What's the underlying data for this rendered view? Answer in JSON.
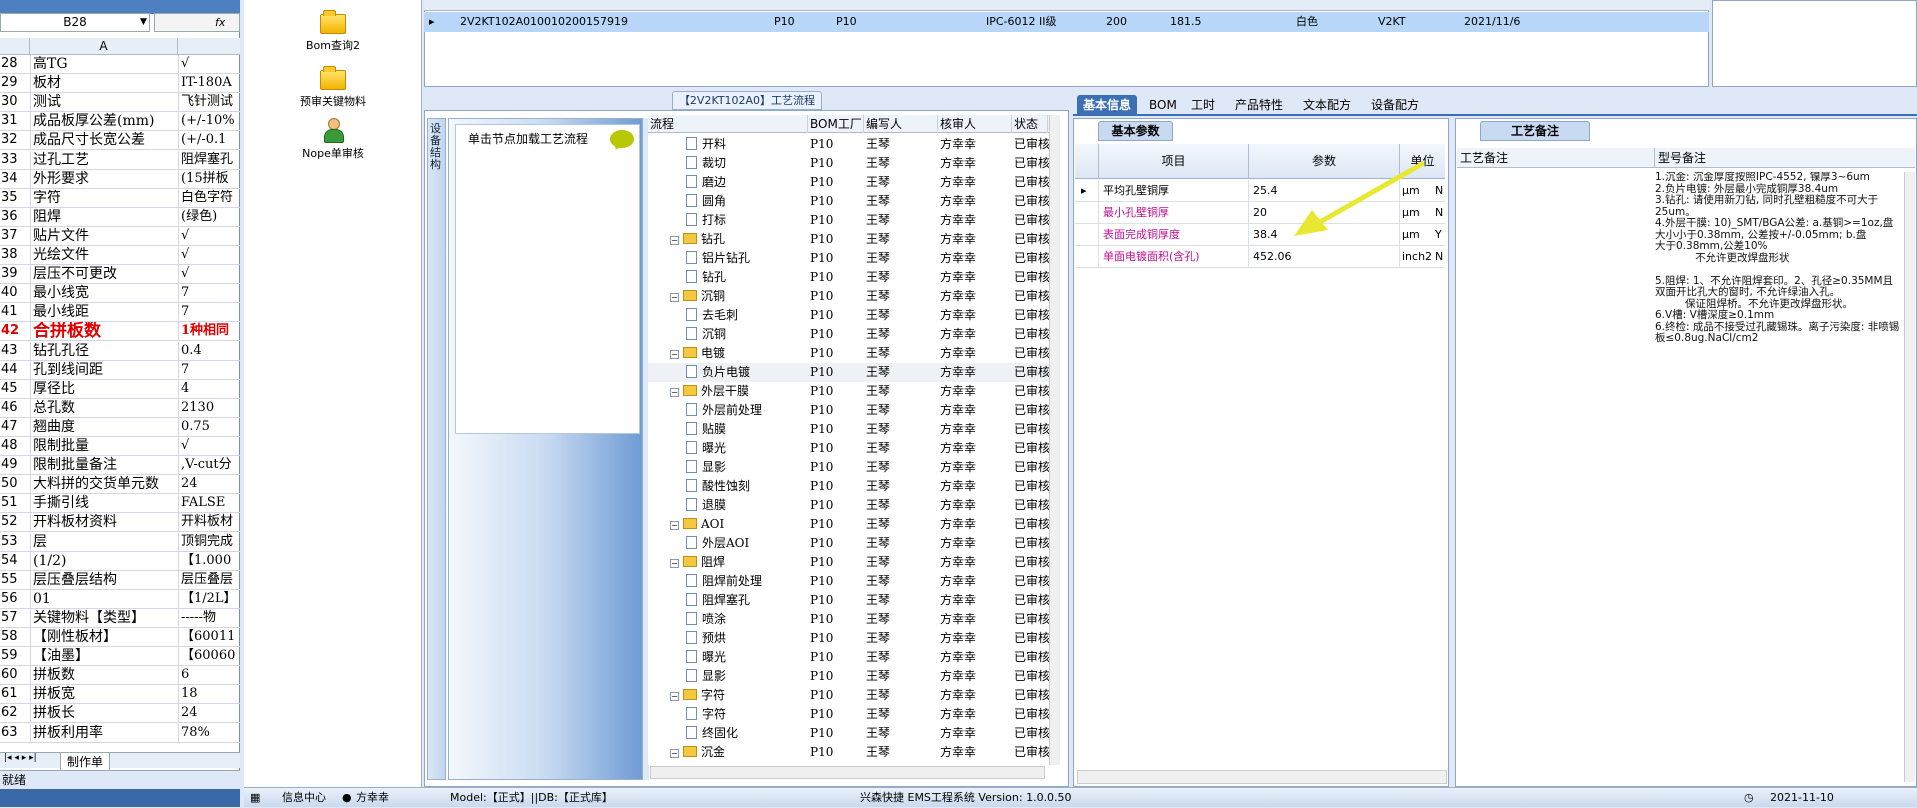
{
  "excel": {
    "name_box": "B28",
    "fx_label": "fx",
    "col_a": "A",
    "rows": [
      {
        "n": "28",
        "a": "高TG",
        "b": "√"
      },
      {
        "n": "29",
        "a": "板材",
        "b": "IT-180A"
      },
      {
        "n": "30",
        "a": "测试",
        "b": "飞针测试"
      },
      {
        "n": "31",
        "a": "成品板厚公差(mm)",
        "b": "(+/-10%"
      },
      {
        "n": "32",
        "a": "成品尺寸长宽公差",
        "b": "(+/-0.1"
      },
      {
        "n": "33",
        "a": "过孔工艺",
        "b": "阻焊塞孔"
      },
      {
        "n": "34",
        "a": "外形要求",
        "b": "(15拼板"
      },
      {
        "n": "35",
        "a": "字符",
        "b": "白色字符"
      },
      {
        "n": "36",
        "a": "阻焊",
        "b": "(绿色)"
      },
      {
        "n": "37",
        "a": "贴片文件",
        "b": "√"
      },
      {
        "n": "38",
        "a": "光绘文件",
        "b": "√"
      },
      {
        "n": "39",
        "a": "层压不可更改",
        "b": "√"
      },
      {
        "n": "40",
        "a": "最小线宽",
        "b": "7"
      },
      {
        "n": "41",
        "a": "最小线距",
        "b": "7"
      },
      {
        "n": "42",
        "a": "合拼板数",
        "b": "1种相同",
        "big": true
      },
      {
        "n": "43",
        "a": "钻孔孔径",
        "b": "0.4"
      },
      {
        "n": "44",
        "a": "孔到线间距",
        "b": "7"
      },
      {
        "n": "45",
        "a": "厚径比",
        "b": "4"
      },
      {
        "n": "46",
        "a": "总孔数",
        "b": "2130"
      },
      {
        "n": "47",
        "a": "翘曲度",
        "b": "0.75"
      },
      {
        "n": "48",
        "a": "限制批量",
        "b": "√"
      },
      {
        "n": "49",
        "a": "限制批量备注",
        "b": ",V-cut分"
      },
      {
        "n": "50",
        "a": "大料拼的交货单元数",
        "b": "24"
      },
      {
        "n": "51",
        "a": "手撕引线",
        "b": "FALSE"
      },
      {
        "n": "52",
        "a": "开料板材资料",
        "b": "开料板材"
      },
      {
        "n": "53",
        "a": "层",
        "b": "顶铜完成"
      },
      {
        "n": "54",
        "a": "(1/2)",
        "b": "【1.000"
      },
      {
        "n": "55",
        "a": "层压叠层结构",
        "b": "层压叠层"
      },
      {
        "n": "56",
        "a": "01",
        "b": "【1/2L】"
      },
      {
        "n": "57",
        "a": "关键物料【类型】",
        "b": "-----物"
      },
      {
        "n": "58",
        "a": "【刚性板材】",
        "b": "【60011"
      },
      {
        "n": "59",
        "a": "【油墨】",
        "b": "【60060"
      },
      {
        "n": "60",
        "a": "拼板数",
        "b": "6"
      },
      {
        "n": "61",
        "a": "拼板宽",
        "b": "18"
      },
      {
        "n": "62",
        "a": "拼板长",
        "b": "24"
      },
      {
        "n": "63",
        "a": "拼板利用率",
        "b": "78%"
      }
    ],
    "sheet_tab": "制作单",
    "status": "就绪"
  },
  "left_tools": [
    {
      "label": "Bom查询2"
    },
    {
      "label": "预审关键物料"
    },
    {
      "label": "Nope单审核"
    }
  ],
  "top_row": {
    "marker": "▸",
    "cols": [
      "2V2KT102A0",
      "10010200157919",
      "P10",
      "P10",
      "IPC-6012 II级",
      "200",
      "181.5",
      "白色",
      "V2KT",
      "2021/11/6"
    ]
  },
  "process": {
    "title": "【2V2KT102A0】工艺流程",
    "side_tab": "设备结构",
    "load_hint": "单击节点加载工艺流程",
    "headers": {
      "flow": "流程",
      "factory": "BOM工厂",
      "writer": "编写人",
      "reviewer": "核审人",
      "status": "状态"
    },
    "rows": [
      {
        "name": "开料",
        "level": 2,
        "f": "P10",
        "w": "王琴",
        "r": "方幸幸",
        "s": "已审核"
      },
      {
        "name": "裁切",
        "level": 2,
        "f": "P10",
        "w": "王琴",
        "r": "方幸幸",
        "s": "已审核"
      },
      {
        "name": "磨边",
        "level": 2,
        "f": "P10",
        "w": "王琴",
        "r": "方幸幸",
        "s": "已审核"
      },
      {
        "name": "圆角",
        "level": 2,
        "f": "P10",
        "w": "王琴",
        "r": "方幸幸",
        "s": "已审核"
      },
      {
        "name": "打标",
        "level": 2,
        "f": "P10",
        "w": "王琴",
        "r": "方幸幸",
        "s": "已审核"
      },
      {
        "name": "钻孔",
        "level": 1,
        "f": "P10",
        "w": "王琴",
        "r": "方幸幸",
        "s": "已审核"
      },
      {
        "name": "铝片钻孔",
        "level": 2,
        "f": "P10",
        "w": "王琴",
        "r": "方幸幸",
        "s": "已审核"
      },
      {
        "name": "钻孔",
        "level": 2,
        "f": "P10",
        "w": "王琴",
        "r": "方幸幸",
        "s": "已审核"
      },
      {
        "name": "沉铜",
        "level": 1,
        "f": "P10",
        "w": "王琴",
        "r": "方幸幸",
        "s": "已审核"
      },
      {
        "name": "去毛刺",
        "level": 2,
        "f": "P10",
        "w": "王琴",
        "r": "方幸幸",
        "s": "已审核"
      },
      {
        "name": "沉铜",
        "level": 2,
        "f": "P10",
        "w": "王琴",
        "r": "方幸幸",
        "s": "已审核"
      },
      {
        "name": "电镀",
        "level": 1,
        "f": "P10",
        "w": "王琴",
        "r": "方幸幸",
        "s": "已审核"
      },
      {
        "name": "负片电镀",
        "level": 2,
        "f": "P10",
        "w": "王琴",
        "r": "方幸幸",
        "s": "已审核"
      },
      {
        "name": "外层干膜",
        "level": 1,
        "f": "P10",
        "w": "王琴",
        "r": "方幸幸",
        "s": "已审核"
      },
      {
        "name": "外层前处理",
        "level": 2,
        "f": "P10",
        "w": "王琴",
        "r": "方幸幸",
        "s": "已审核"
      },
      {
        "name": "贴膜",
        "level": 2,
        "f": "P10",
        "w": "王琴",
        "r": "方幸幸",
        "s": "已审核"
      },
      {
        "name": "曝光",
        "level": 2,
        "f": "P10",
        "w": "王琴",
        "r": "方幸幸",
        "s": "已审核"
      },
      {
        "name": "显影",
        "level": 2,
        "f": "P10",
        "w": "王琴",
        "r": "方幸幸",
        "s": "已审核"
      },
      {
        "name": "酸性蚀刻",
        "level": 2,
        "f": "P10",
        "w": "王琴",
        "r": "方幸幸",
        "s": "已审核"
      },
      {
        "name": "退膜",
        "level": 2,
        "f": "P10",
        "w": "王琴",
        "r": "方幸幸",
        "s": "已审核"
      },
      {
        "name": "AOI",
        "level": 1,
        "f": "P10",
        "w": "王琴",
        "r": "方幸幸",
        "s": "已审核"
      },
      {
        "name": "外层AOI",
        "level": 2,
        "f": "P10",
        "w": "王琴",
        "r": "方幸幸",
        "s": "已审核"
      },
      {
        "name": "阻焊",
        "level": 1,
        "f": "P10",
        "w": "王琴",
        "r": "方幸幸",
        "s": "已审核"
      },
      {
        "name": "阻焊前处理",
        "level": 2,
        "f": "P10",
        "w": "王琴",
        "r": "方幸幸",
        "s": "已审核"
      },
      {
        "name": "阻焊塞孔",
        "level": 2,
        "f": "P10",
        "w": "王琴",
        "r": "方幸幸",
        "s": "已审核"
      },
      {
        "name": "喷涂",
        "level": 2,
        "f": "P10",
        "w": "王琴",
        "r": "方幸幸",
        "s": "已审核"
      },
      {
        "name": "预烘",
        "level": 2,
        "f": "P10",
        "w": "王琴",
        "r": "方幸幸",
        "s": "已审核"
      },
      {
        "name": "曝光",
        "level": 2,
        "f": "P10",
        "w": "王琴",
        "r": "方幸幸",
        "s": "已审核"
      },
      {
        "name": "显影",
        "level": 2,
        "f": "P10",
        "w": "王琴",
        "r": "方幸幸",
        "s": "已审核"
      },
      {
        "name": "字符",
        "level": 1,
        "f": "P10",
        "w": "王琴",
        "r": "方幸幸",
        "s": "已审核"
      },
      {
        "name": "字符",
        "level": 2,
        "f": "P10",
        "w": "王琴",
        "r": "方幸幸",
        "s": "已审核"
      },
      {
        "name": "终固化",
        "level": 2,
        "f": "P10",
        "w": "王琴",
        "r": "方幸幸",
        "s": "已审核"
      },
      {
        "name": "沉金",
        "level": 1,
        "f": "P10",
        "w": "王琴",
        "r": "方幸幸",
        "s": "已审核"
      }
    ]
  },
  "info": {
    "tabs": [
      "基本信息",
      "BOM",
      "工时",
      "产品特性",
      "文本配方",
      "设备配方"
    ],
    "basic_tab": "基本参数",
    "headers": {
      "item": "项目",
      "param": "参数",
      "unit": "单位"
    },
    "rows": [
      {
        "item": "平均孔壁铜厚",
        "param": "25.4",
        "unit": "μm",
        "flag": "N",
        "color": "#000000"
      },
      {
        "item": "最小孔壁铜厚",
        "param": "20",
        "unit": "μm",
        "flag": "N",
        "color": "#c01090"
      },
      {
        "item": "表面完成铜厚度",
        "param": "38.4",
        "unit": "μm",
        "flag": "Y",
        "color": "#c01090"
      },
      {
        "item": "单面电镀面积(含孔)",
        "param": "452.06",
        "unit": "inch2",
        "flag": "N",
        "color": "#c01090"
      }
    ],
    "arrow_color": "#e8e830"
  },
  "craft": {
    "tab": "工艺备注",
    "headers": {
      "note": "工艺备注",
      "model": "型号备注"
    },
    "model_note": "1.沉金: 沉金厚度按照IPC-4552, 镍厚3~6um\n2.负片电镀: 外层最小完成铜厚38.4um\n3.钻孔: 请使用新刀钻, 同时孔壁粗糙度不可大于25um。\n4.外层干膜: 10)_SMT/BGA公差: a.基铜>=1oz,盘大小小于0.38mm, 公差按+/-0.05mm; b.盘            大于0.38mm,公差10%\n            不允许更改焊盘形状\n\n5.阻焊: 1、不允许阻焊套印。2、孔径≥0.35MM且双面开比孔大的窗时, 不允许绿油入孔。\n         保证阻焊桥。不允许更改焊盘形状。\n6.V槽: V槽深度≥0.1mm\n6.终检: 成品不接受过孔藏锡珠。离子污染度: 非喷锡板≤0.8ug.NaCl/cm2"
  },
  "statusbar": {
    "info_center": "信息中心",
    "user": "方幸幸",
    "model": "Model:【正式】||DB:【正式库】",
    "app": "兴森快捷 EMS工程系统 Version: 1.0.0.50",
    "date": "2021-11-10"
  }
}
